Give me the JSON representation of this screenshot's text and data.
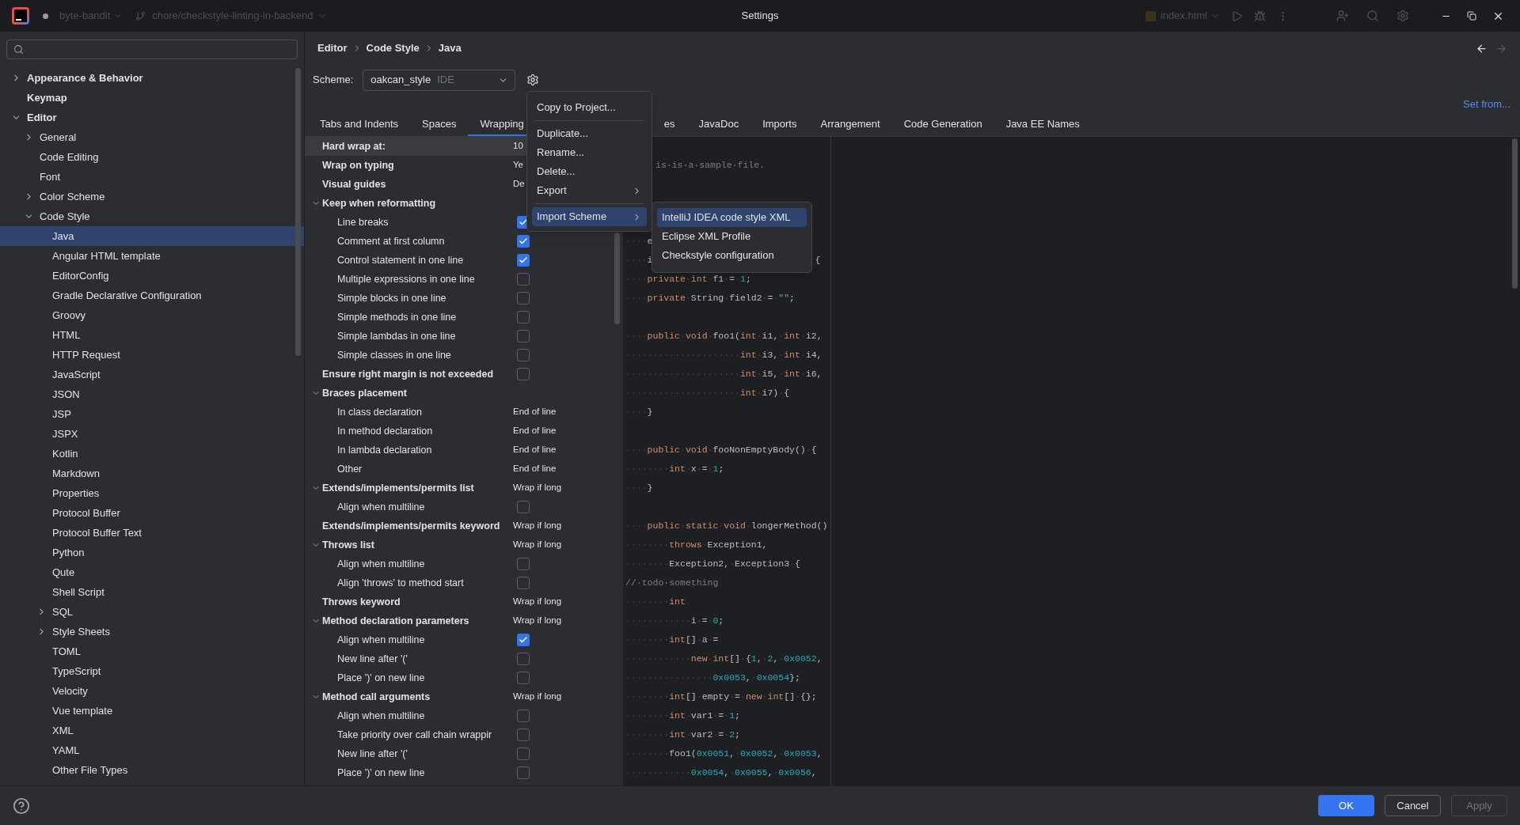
{
  "title_bar": {
    "project": "byte-bandit",
    "branch": "chore/checkstyle-linting-in-backend",
    "title": "Settings",
    "run_config": "index.html"
  },
  "sidebar": {
    "items": [
      {
        "label": "Appearance & Behavior",
        "expanded": false,
        "selected": false
      },
      {
        "label": "Keymap",
        "selected": false
      },
      {
        "label": "Editor",
        "expanded": true,
        "selected": false,
        "children": [
          {
            "label": "General",
            "expanded": false,
            "selected": false
          },
          {
            "label": "Code Editing",
            "selected": false
          },
          {
            "label": "Font",
            "selected": false
          },
          {
            "label": "Color Scheme",
            "expanded": false,
            "selected": false
          },
          {
            "label": "Code Style",
            "expanded": true,
            "selected": false,
            "children": [
              {
                "label": "Java",
                "selected": true
              },
              {
                "label": "Angular HTML template",
                "selected": false
              },
              {
                "label": "EditorConfig",
                "selected": false
              },
              {
                "label": "Gradle Declarative Configuration",
                "selected": false
              },
              {
                "label": "Groovy",
                "selected": false
              },
              {
                "label": "HTML",
                "selected": false
              },
              {
                "label": "HTTP Request",
                "selected": false
              },
              {
                "label": "JavaScript",
                "selected": false
              },
              {
                "label": "JSON",
                "selected": false
              },
              {
                "label": "JSP",
                "selected": false
              },
              {
                "label": "JSPX",
                "selected": false
              },
              {
                "label": "Kotlin",
                "selected": false
              },
              {
                "label": "Markdown",
                "selected": false
              },
              {
                "label": "Properties",
                "selected": false
              },
              {
                "label": "Protocol Buffer",
                "selected": false
              },
              {
                "label": "Protocol Buffer Text",
                "selected": false
              },
              {
                "label": "Python",
                "selected": false
              },
              {
                "label": "Qute",
                "selected": false
              },
              {
                "label": "Shell Script",
                "selected": false
              },
              {
                "label": "SQL",
                "expanded": false,
                "selected": false
              },
              {
                "label": "Style Sheets",
                "expanded": false,
                "selected": false
              },
              {
                "label": "TOML",
                "selected": false
              },
              {
                "label": "TypeScript",
                "selected": false
              },
              {
                "label": "Velocity",
                "selected": false
              },
              {
                "label": "Vue template",
                "selected": false
              },
              {
                "label": "XML",
                "selected": false
              },
              {
                "label": "YAML",
                "selected": false
              },
              {
                "label": "Other File Types",
                "selected": false
              }
            ]
          }
        ]
      }
    ]
  },
  "breadcrumb": [
    "Editor",
    "Code Style",
    "Java"
  ],
  "nav": {
    "back_disabled": false,
    "forward_disabled": true
  },
  "scheme": {
    "label": "Scheme:",
    "value": "oakcan_style",
    "tag": "IDE"
  },
  "set_from": "Set from...",
  "tabs": [
    {
      "kind": "tab",
      "label": "Tabs and Indents",
      "selected": false
    },
    {
      "kind": "tab",
      "label": "Spaces",
      "selected": false
    },
    {
      "kind": "tab",
      "label": "Wrapping",
      "selected": true
    },
    {
      "kind": "partial",
      "label": "es",
      "selected": false
    },
    {
      "kind": "tab",
      "label": "JavaDoc",
      "selected": false
    },
    {
      "kind": "tab",
      "label": "Imports",
      "selected": false
    },
    {
      "kind": "tab",
      "label": "Arrangement",
      "selected": false
    },
    {
      "kind": "tab",
      "label": "Code Generation",
      "selected": false
    },
    {
      "kind": "tab",
      "label": "Java EE Names",
      "selected": false
    }
  ],
  "settings": [
    {
      "kind": "value",
      "label": "Hard wrap at:",
      "value": "10",
      "selected": true
    },
    {
      "kind": "value",
      "label": "Wrap on typing",
      "value": "Ye",
      "selected": false
    },
    {
      "kind": "value",
      "label": "Visual guides",
      "value": "De",
      "selected": false
    },
    {
      "kind": "group",
      "label": "Keep when reformatting",
      "expanded": true,
      "selected": false,
      "children": [
        {
          "kind": "checkbox",
          "label": "Line breaks",
          "checked": true,
          "selected": false
        },
        {
          "kind": "checkbox",
          "label": "Comment at first column",
          "checked": true,
          "selected": false
        },
        {
          "kind": "checkbox",
          "label": "Control statement in one line",
          "checked": true,
          "selected": false
        },
        {
          "kind": "checkbox",
          "label": "Multiple expressions in one line",
          "checked": false,
          "selected": false
        },
        {
          "kind": "checkbox",
          "label": "Simple blocks in one line",
          "checked": false,
          "selected": false
        },
        {
          "kind": "checkbox",
          "label": "Simple methods in one line",
          "checked": false,
          "selected": false
        },
        {
          "kind": "checkbox",
          "label": "Simple lambdas in one line",
          "checked": false,
          "selected": false
        },
        {
          "kind": "checkbox",
          "label": "Simple classes in one line",
          "checked": false,
          "selected": false
        }
      ]
    },
    {
      "kind": "checkbox",
      "label": "Ensure right margin is not exceeded",
      "checked": false,
      "selected": false
    },
    {
      "kind": "group",
      "label": "Braces placement",
      "expanded": true,
      "selected": false,
      "children": [
        {
          "kind": "value",
          "label": "In class declaration",
          "value": "End of line",
          "selected": false
        },
        {
          "kind": "value",
          "label": "In method declaration",
          "value": "End of line",
          "selected": false
        },
        {
          "kind": "value",
          "label": "In lambda declaration",
          "value": "End of line",
          "selected": false
        },
        {
          "kind": "value",
          "label": "Other",
          "value": "End of line",
          "selected": false
        }
      ]
    },
    {
      "kind": "group",
      "label": "Extends/implements/permits list",
      "value": "Wrap if long",
      "expanded": true,
      "selected": false,
      "children": [
        {
          "kind": "checkbox",
          "label": "Align when multiline",
          "checked": false,
          "selected": false
        }
      ]
    },
    {
      "kind": "value",
      "label": "Extends/implements/permits keyword",
      "value": "Wrap if long",
      "selected": false
    },
    {
      "kind": "group",
      "label": "Throws list",
      "value": "Wrap if long",
      "expanded": true,
      "selected": false,
      "children": [
        {
          "kind": "checkbox",
          "label": "Align when multiline",
          "checked": false,
          "selected": false
        },
        {
          "kind": "checkbox",
          "label": "Align 'throws' to method start",
          "checked": false,
          "selected": false
        }
      ]
    },
    {
      "kind": "value",
      "label": "Throws keyword",
      "value": "Wrap if long",
      "selected": false
    },
    {
      "kind": "group",
      "label": "Method declaration parameters",
      "value": "Wrap if long",
      "expanded": true,
      "selected": false,
      "children": [
        {
          "kind": "checkbox",
          "label": "Align when multiline",
          "checked": true,
          "selected": false
        },
        {
          "kind": "checkbox",
          "label": "New line after '('",
          "checked": false,
          "selected": false
        },
        {
          "kind": "checkbox",
          "label": "Place ')' on new line",
          "checked": false,
          "selected": false
        }
      ]
    },
    {
      "kind": "group",
      "label": "Method call arguments",
      "value": "Wrap if long",
      "expanded": true,
      "selected": false,
      "children": [
        {
          "kind": "checkbox",
          "label": "Align when multiline",
          "checked": false,
          "selected": false
        },
        {
          "kind": "checkbox",
          "label": "Take priority over call chain wrappir",
          "checked": false,
          "selected": false
        },
        {
          "kind": "checkbox",
          "label": "New line after '('",
          "checked": false,
          "selected": false
        },
        {
          "kind": "checkbox",
          "label": "Place ')' on new line",
          "checked": false,
          "selected": false
        }
      ]
    }
  ],
  "code_lines": [
    {
      "kind": "after-menu",
      "segs": [
        {
          "kind": "cmt",
          "text": "is·is·a·sample·file."
        }
      ]
    },
    {
      "kind": "blank"
    },
    {
      "kind": "blank"
    },
    {
      "kind": "blank"
    },
    {
      "kind": "code",
      "segs": [
        {
          "kind": "ws",
          "text": "····"
        },
        {
          "kind": "id",
          "text": "e"
        }
      ]
    },
    {
      "kind": "split",
      "segs": [
        {
          "kind": "ws",
          "text": "····"
        },
        {
          "kind": "id",
          "text": "i"
        }
      ],
      "after": [
        {
          "kind": "id",
          "text": "{"
        }
      ]
    },
    {
      "kind": "code",
      "segs": [
        {
          "kind": "ws",
          "text": "····"
        },
        {
          "kind": "kw",
          "text": "private"
        },
        {
          "kind": "ws",
          "text": "·"
        },
        {
          "kind": "kw",
          "text": "int"
        },
        {
          "kind": "ws",
          "text": "·"
        },
        {
          "kind": "id",
          "text": "f1"
        },
        {
          "kind": "ws",
          "text": "·"
        },
        {
          "kind": "id",
          "text": "="
        },
        {
          "kind": "ws",
          "text": "·"
        },
        {
          "kind": "num",
          "text": "1"
        },
        {
          "kind": "id",
          "text": ";"
        }
      ]
    },
    {
      "kind": "code",
      "segs": [
        {
          "kind": "ws",
          "text": "····"
        },
        {
          "kind": "kw",
          "text": "private"
        },
        {
          "kind": "ws",
          "text": "·"
        },
        {
          "kind": "id",
          "text": "String"
        },
        {
          "kind": "ws",
          "text": "·"
        },
        {
          "kind": "id",
          "text": "field2"
        },
        {
          "kind": "ws",
          "text": "·"
        },
        {
          "kind": "id",
          "text": "="
        },
        {
          "kind": "ws",
          "text": "·"
        },
        {
          "kind": "str",
          "text": "\"\""
        },
        {
          "kind": "id",
          "text": ";"
        }
      ]
    },
    {
      "kind": "blank"
    },
    {
      "kind": "code",
      "segs": [
        {
          "kind": "ws",
          "text": "····"
        },
        {
          "kind": "kw",
          "text": "public"
        },
        {
          "kind": "ws",
          "text": "·"
        },
        {
          "kind": "kw",
          "text": "void"
        },
        {
          "kind": "ws",
          "text": "·"
        },
        {
          "kind": "id",
          "text": "foo1("
        },
        {
          "kind": "kw",
          "text": "int"
        },
        {
          "kind": "ws",
          "text": "·"
        },
        {
          "kind": "id",
          "text": "i1,"
        },
        {
          "kind": "ws",
          "text": "·"
        },
        {
          "kind": "kw",
          "text": "int"
        },
        {
          "kind": "ws",
          "text": "·"
        },
        {
          "kind": "id",
          "text": "i2,"
        }
      ]
    },
    {
      "kind": "code",
      "segs": [
        {
          "kind": "ws",
          "text": "·····················"
        },
        {
          "kind": "kw",
          "text": "int"
        },
        {
          "kind": "ws",
          "text": "·"
        },
        {
          "kind": "id",
          "text": "i3,"
        },
        {
          "kind": "ws",
          "text": "·"
        },
        {
          "kind": "kw",
          "text": "int"
        },
        {
          "kind": "ws",
          "text": "·"
        },
        {
          "kind": "id",
          "text": "i4,"
        }
      ]
    },
    {
      "kind": "code",
      "segs": [
        {
          "kind": "ws",
          "text": "·····················"
        },
        {
          "kind": "kw",
          "text": "int"
        },
        {
          "kind": "ws",
          "text": "·"
        },
        {
          "kind": "id",
          "text": "i5,"
        },
        {
          "kind": "ws",
          "text": "·"
        },
        {
          "kind": "kw",
          "text": "int"
        },
        {
          "kind": "ws",
          "text": "·"
        },
        {
          "kind": "id",
          "text": "i6,"
        }
      ]
    },
    {
      "kind": "code",
      "segs": [
        {
          "kind": "ws",
          "text": "·····················"
        },
        {
          "kind": "kw",
          "text": "int"
        },
        {
          "kind": "ws",
          "text": "·"
        },
        {
          "kind": "id",
          "text": "i7)"
        },
        {
          "kind": "ws",
          "text": "·"
        },
        {
          "kind": "id",
          "text": "{"
        }
      ]
    },
    {
      "kind": "code",
      "segs": [
        {
          "kind": "ws",
          "text": "····"
        },
        {
          "kind": "id",
          "text": "}"
        }
      ]
    },
    {
      "kind": "blank"
    },
    {
      "kind": "code",
      "segs": [
        {
          "kind": "ws",
          "text": "····"
        },
        {
          "kind": "kw",
          "text": "public"
        },
        {
          "kind": "ws",
          "text": "·"
        },
        {
          "kind": "kw",
          "text": "void"
        },
        {
          "kind": "ws",
          "text": "·"
        },
        {
          "kind": "id",
          "text": "fooNonEmptyBody()"
        },
        {
          "kind": "ws",
          "text": "·"
        },
        {
          "kind": "id",
          "text": "{"
        }
      ]
    },
    {
      "kind": "code",
      "segs": [
        {
          "kind": "ws",
          "text": "········"
        },
        {
          "kind": "kw",
          "text": "int"
        },
        {
          "kind": "ws",
          "text": "·"
        },
        {
          "kind": "id",
          "text": "x"
        },
        {
          "kind": "ws",
          "text": "·"
        },
        {
          "kind": "id",
          "text": "="
        },
        {
          "kind": "ws",
          "text": "·"
        },
        {
          "kind": "num",
          "text": "1"
        },
        {
          "kind": "id",
          "text": ";"
        }
      ]
    },
    {
      "kind": "code",
      "segs": [
        {
          "kind": "ws",
          "text": "····"
        },
        {
          "kind": "id",
          "text": "}"
        }
      ]
    },
    {
      "kind": "blank"
    },
    {
      "kind": "code",
      "segs": [
        {
          "kind": "ws",
          "text": "····"
        },
        {
          "kind": "kw",
          "text": "public"
        },
        {
          "kind": "ws",
          "text": "·"
        },
        {
          "kind": "kw",
          "text": "static"
        },
        {
          "kind": "ws",
          "text": "·"
        },
        {
          "kind": "kw",
          "text": "void"
        },
        {
          "kind": "ws",
          "text": "·"
        },
        {
          "kind": "id",
          "text": "longerMethod()"
        }
      ]
    },
    {
      "kind": "code",
      "segs": [
        {
          "kind": "ws",
          "text": "········"
        },
        {
          "kind": "kw",
          "text": "throws"
        },
        {
          "kind": "ws",
          "text": "·"
        },
        {
          "kind": "id",
          "text": "Exception1,"
        }
      ]
    },
    {
      "kind": "code",
      "segs": [
        {
          "kind": "ws",
          "text": "········"
        },
        {
          "kind": "id",
          "text": "Exception2,"
        },
        {
          "kind": "ws",
          "text": "·"
        },
        {
          "kind": "id",
          "text": "Exception3"
        },
        {
          "kind": "ws",
          "text": "·"
        },
        {
          "kind": "id",
          "text": "{"
        }
      ]
    },
    {
      "kind": "code",
      "segs": [
        {
          "kind": "cmt",
          "text": "//·todo·something"
        }
      ]
    },
    {
      "kind": "code",
      "segs": [
        {
          "kind": "ws",
          "text": "········"
        },
        {
          "kind": "kw",
          "text": "int"
        }
      ]
    },
    {
      "kind": "code",
      "segs": [
        {
          "kind": "ws",
          "text": "············"
        },
        {
          "kind": "id",
          "text": "i"
        },
        {
          "kind": "ws",
          "text": "·"
        },
        {
          "kind": "id",
          "text": "="
        },
        {
          "kind": "ws",
          "text": "·"
        },
        {
          "kind": "num",
          "text": "0"
        },
        {
          "kind": "id",
          "text": ";"
        }
      ]
    },
    {
      "kind": "code",
      "segs": [
        {
          "kind": "ws",
          "text": "········"
        },
        {
          "kind": "kw",
          "text": "int"
        },
        {
          "kind": "id",
          "text": "[]"
        },
        {
          "kind": "ws",
          "text": "·"
        },
        {
          "kind": "id",
          "text": "a"
        },
        {
          "kind": "ws",
          "text": "·"
        },
        {
          "kind": "id",
          "text": "="
        }
      ]
    },
    {
      "kind": "code",
      "segs": [
        {
          "kind": "ws",
          "text": "············"
        },
        {
          "kind": "kw",
          "text": "new"
        },
        {
          "kind": "ws",
          "text": "·"
        },
        {
          "kind": "kw",
          "text": "int"
        },
        {
          "kind": "id",
          "text": "[]"
        },
        {
          "kind": "ws",
          "text": "·"
        },
        {
          "kind": "id",
          "text": "{"
        },
        {
          "kind": "num",
          "text": "1"
        },
        {
          "kind": "id",
          "text": ","
        },
        {
          "kind": "ws",
          "text": "·"
        },
        {
          "kind": "num",
          "text": "2"
        },
        {
          "kind": "id",
          "text": ","
        },
        {
          "kind": "ws",
          "text": "·"
        },
        {
          "kind": "num",
          "text": "0x0052"
        },
        {
          "kind": "id",
          "text": ","
        }
      ]
    },
    {
      "kind": "code",
      "segs": [
        {
          "kind": "ws",
          "text": "················"
        },
        {
          "kind": "num",
          "text": "0x0053"
        },
        {
          "kind": "id",
          "text": ","
        },
        {
          "kind": "ws",
          "text": "·"
        },
        {
          "kind": "num",
          "text": "0x0054"
        },
        {
          "kind": "id",
          "text": "};"
        }
      ]
    },
    {
      "kind": "code",
      "segs": [
        {
          "kind": "ws",
          "text": "········"
        },
        {
          "kind": "kw",
          "text": "int"
        },
        {
          "kind": "id",
          "text": "[]"
        },
        {
          "kind": "ws",
          "text": "·"
        },
        {
          "kind": "id",
          "text": "empty"
        },
        {
          "kind": "ws",
          "text": "·"
        },
        {
          "kind": "id",
          "text": "="
        },
        {
          "kind": "ws",
          "text": "·"
        },
        {
          "kind": "kw",
          "text": "new"
        },
        {
          "kind": "ws",
          "text": "·"
        },
        {
          "kind": "kw",
          "text": "int"
        },
        {
          "kind": "id",
          "text": "[]"
        },
        {
          "kind": "ws",
          "text": "·"
        },
        {
          "kind": "id",
          "text": "{};"
        }
      ]
    },
    {
      "kind": "code",
      "segs": [
        {
          "kind": "ws",
          "text": "········"
        },
        {
          "kind": "kw",
          "text": "int"
        },
        {
          "kind": "ws",
          "text": "·"
        },
        {
          "kind": "id",
          "text": "var1"
        },
        {
          "kind": "ws",
          "text": "·"
        },
        {
          "kind": "id",
          "text": "="
        },
        {
          "kind": "ws",
          "text": "·"
        },
        {
          "kind": "num",
          "text": "1"
        },
        {
          "kind": "id",
          "text": ";"
        }
      ]
    },
    {
      "kind": "code",
      "segs": [
        {
          "kind": "ws",
          "text": "········"
        },
        {
          "kind": "kw",
          "text": "int"
        },
        {
          "kind": "ws",
          "text": "·"
        },
        {
          "kind": "id",
          "text": "var2"
        },
        {
          "kind": "ws",
          "text": "·"
        },
        {
          "kind": "id",
          "text": "="
        },
        {
          "kind": "ws",
          "text": "·"
        },
        {
          "kind": "num",
          "text": "2"
        },
        {
          "kind": "id",
          "text": ";"
        }
      ]
    },
    {
      "kind": "code",
      "segs": [
        {
          "kind": "ws",
          "text": "········"
        },
        {
          "kind": "id",
          "text": "foo1("
        },
        {
          "kind": "num",
          "text": "0x0051"
        },
        {
          "kind": "id",
          "text": ","
        },
        {
          "kind": "ws",
          "text": "·"
        },
        {
          "kind": "num",
          "text": "0x0052"
        },
        {
          "kind": "id",
          "text": ","
        },
        {
          "kind": "ws",
          "text": "·"
        },
        {
          "kind": "num",
          "text": "0x0053"
        },
        {
          "kind": "id",
          "text": ","
        }
      ]
    },
    {
      "kind": "code",
      "segs": [
        {
          "kind": "ws",
          "text": "············"
        },
        {
          "kind": "num",
          "text": "0x0054"
        },
        {
          "kind": "id",
          "text": ","
        },
        {
          "kind": "ws",
          "text": "·"
        },
        {
          "kind": "num",
          "text": "0x0055"
        },
        {
          "kind": "id",
          "text": ","
        },
        {
          "kind": "ws",
          "text": "·"
        },
        {
          "kind": "num",
          "text": "0x0056"
        },
        {
          "kind": "id",
          "text": ","
        }
      ]
    }
  ],
  "scheme_menu": {
    "items": [
      {
        "kind": "item",
        "label": "Copy to Project...",
        "has_submenu": false,
        "selected": false
      },
      {
        "kind": "separator"
      },
      {
        "kind": "item",
        "label": "Duplicate...",
        "has_submenu": false,
        "selected": false
      },
      {
        "kind": "item",
        "label": "Rename...",
        "has_submenu": false,
        "selected": false
      },
      {
        "kind": "item",
        "label": "Delete...",
        "has_submenu": false,
        "selected": false
      },
      {
        "kind": "item",
        "label": "Export",
        "has_submenu": true,
        "selected": false
      },
      {
        "kind": "separator"
      },
      {
        "kind": "item",
        "label": "Import Scheme",
        "has_submenu": true,
        "selected": true
      }
    ]
  },
  "import_submenu": {
    "items": [
      {
        "kind": "item",
        "label": "IntelliJ IDEA code style XML",
        "has_submenu": false,
        "selected": true
      },
      {
        "kind": "item",
        "label": "Eclipse XML Profile",
        "has_submenu": false,
        "selected": false
      },
      {
        "kind": "item",
        "label": "Checkstyle configuration",
        "has_submenu": false,
        "selected": false
      }
    ]
  },
  "buttons": [
    {
      "label": "OK",
      "primary": true,
      "disabled": false
    },
    {
      "label": "Cancel",
      "primary": false,
      "disabled": false
    },
    {
      "label": "Apply",
      "primary": false,
      "disabled": true
    }
  ]
}
